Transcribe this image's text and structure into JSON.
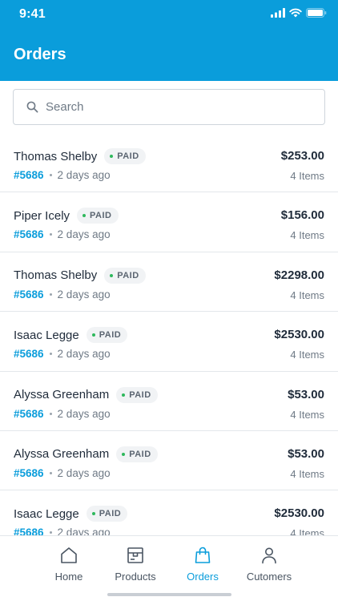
{
  "status": {
    "time": "9:41"
  },
  "header": {
    "title": "Orders"
  },
  "search": {
    "placeholder": "Search",
    "value": ""
  },
  "colors": {
    "brand": "#0a9ddb",
    "paid_dot": "#2eb85c"
  },
  "orders": [
    {
      "customer": "Thomas Shelby",
      "status": "PAID",
      "id": "#5686",
      "time": "2 days ago",
      "total": "$253.00",
      "items": "4 Items"
    },
    {
      "customer": "Piper Icely",
      "status": "PAID",
      "id": "#5686",
      "time": "2 days ago",
      "total": "$156.00",
      "items": "4 Items"
    },
    {
      "customer": "Thomas Shelby",
      "status": "PAID",
      "id": "#5686",
      "time": "2 days ago",
      "total": "$2298.00",
      "items": "4 Items"
    },
    {
      "customer": "Isaac Legge",
      "status": "PAID",
      "id": "#5686",
      "time": "2 days ago",
      "total": "$2530.00",
      "items": "4 Items"
    },
    {
      "customer": "Alyssa Greenham",
      "status": "PAID",
      "id": "#5686",
      "time": "2 days ago",
      "total": "$53.00",
      "items": "4 Items"
    },
    {
      "customer": "Alyssa Greenham",
      "status": "PAID",
      "id": "#5686",
      "time": "2 days ago",
      "total": "$53.00",
      "items": "4 Items"
    },
    {
      "customer": "Isaac Legge",
      "status": "PAID",
      "id": "#5686",
      "time": "2 days ago",
      "total": "$2530.00",
      "items": "4 Items"
    }
  ],
  "tabs": [
    {
      "label": "Home",
      "icon": "home-icon",
      "active": false
    },
    {
      "label": "Products",
      "icon": "box-icon",
      "active": false
    },
    {
      "label": "Orders",
      "icon": "shopping-bag-icon",
      "active": true
    },
    {
      "label": "Cutomers",
      "icon": "user-icon",
      "active": false
    }
  ]
}
